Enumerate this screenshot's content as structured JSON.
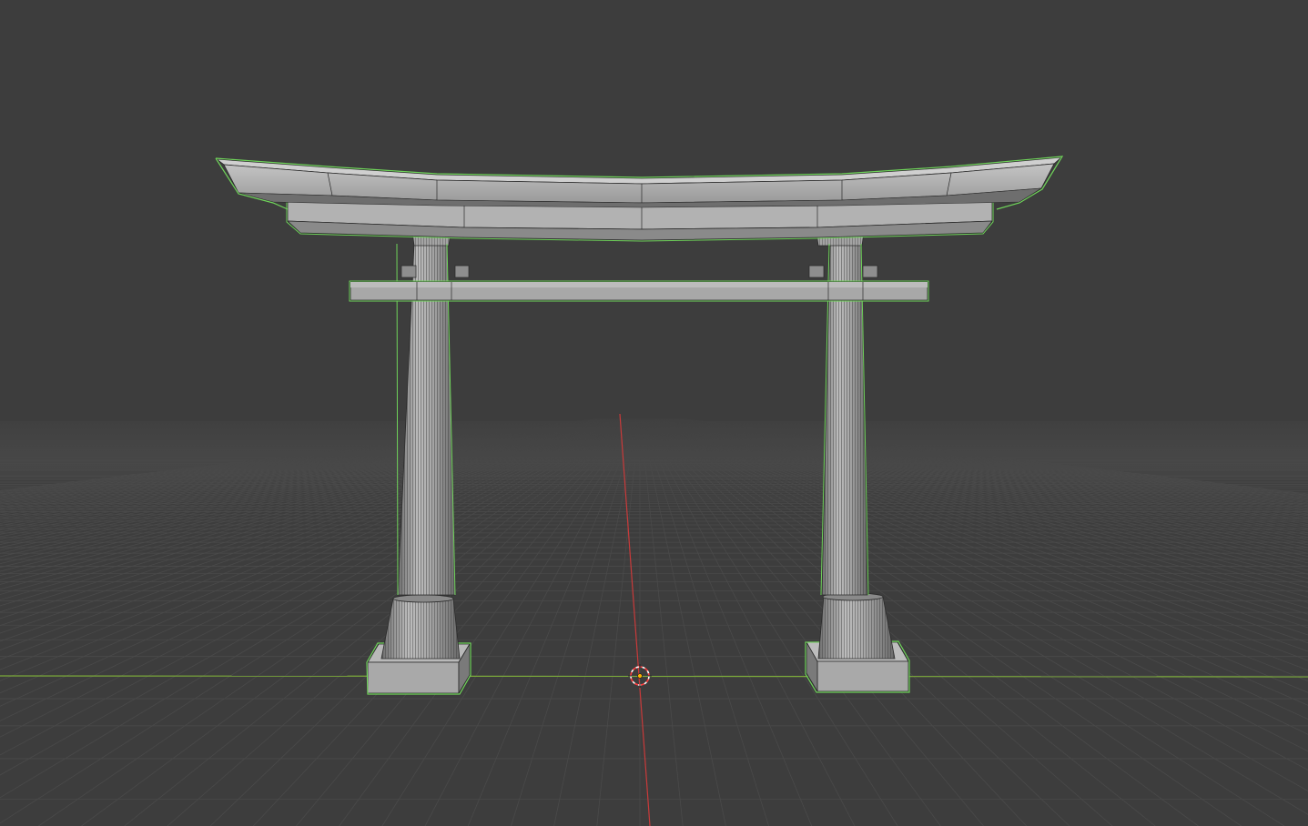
{
  "app": {
    "type": "3d-viewport",
    "view": "perspective",
    "shading": "solid-wireframe"
  },
  "scene": {
    "object": "torii-gate",
    "selected": true,
    "parts": [
      "kasagi-top-beam",
      "shimaki-lower-beam",
      "nuki-tie-beam",
      "left-pillar",
      "right-pillar",
      "left-pillar-base",
      "right-pillar-base"
    ],
    "grid_floor": true,
    "x_axis_visible": true,
    "y_axis_visible": true
  },
  "cursor": {
    "icon": "3d-cursor-icon"
  },
  "colors": {
    "background": "#3d3d3d",
    "grid_line": "#4a4a4a",
    "x_axis": "#8fbf3a",
    "y_axis": "#c93a3a",
    "selection_outline": "#6fd35a",
    "mesh_fill": "#9e9e9e",
    "mesh_light": "#b5b5b5",
    "mesh_dark": "#6d6d6d",
    "wire": "#2a2a2a",
    "cursor_red": "#ff3b3b",
    "origin_dot": "#ffb000"
  }
}
